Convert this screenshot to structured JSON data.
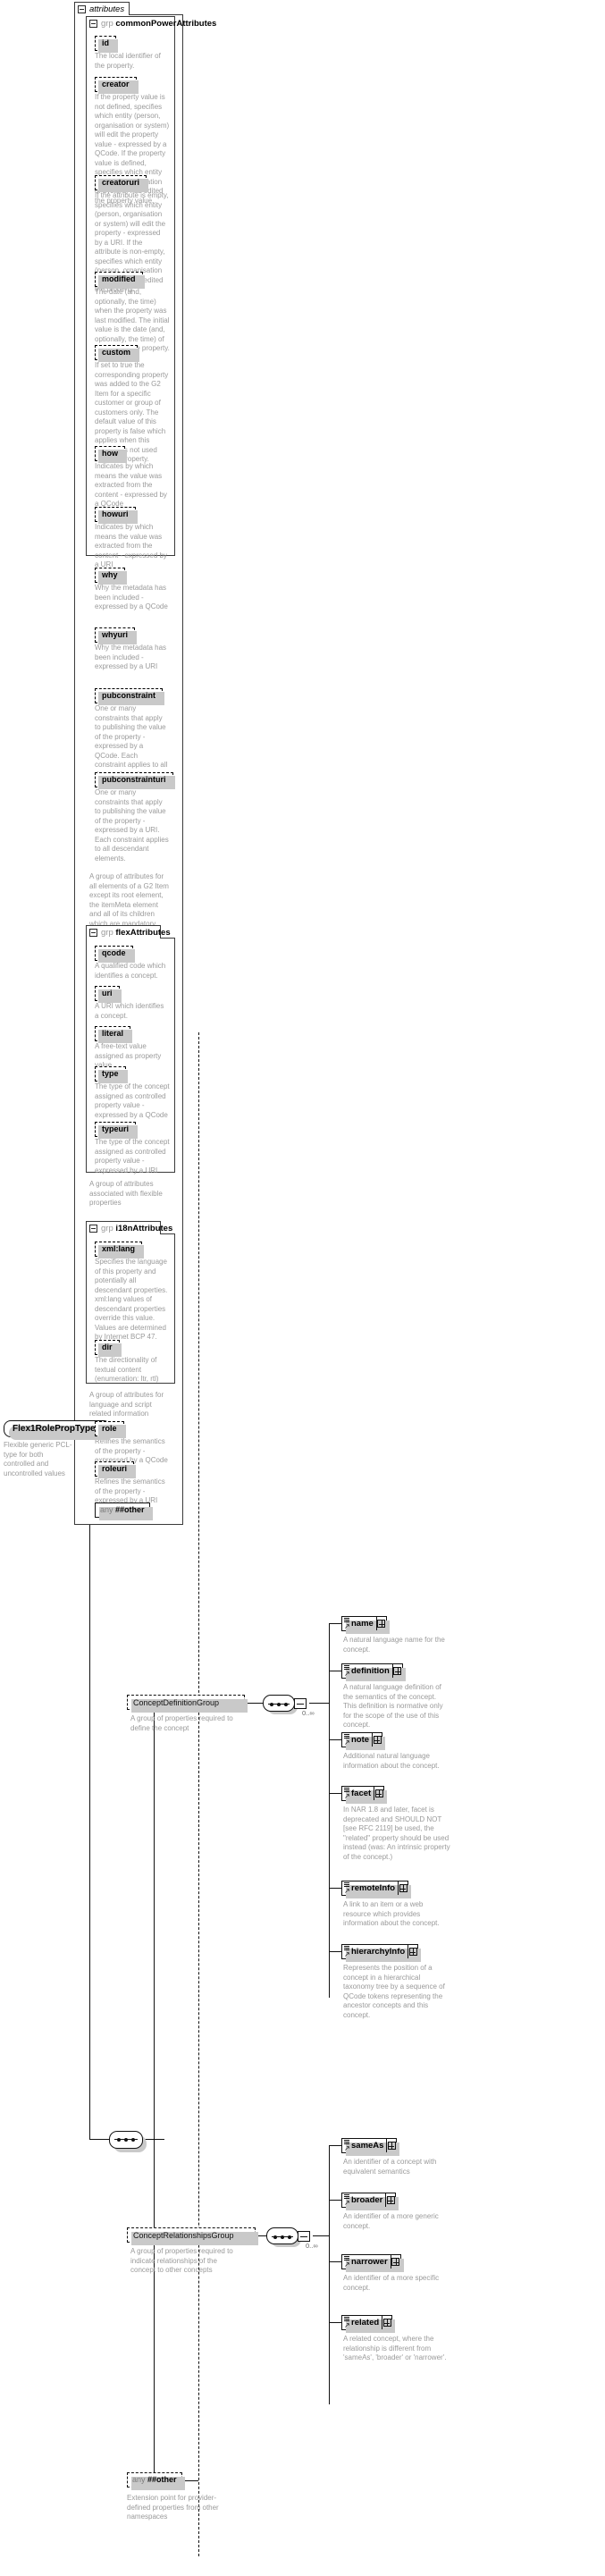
{
  "diagram": {
    "type": "xsd-schema-documentation",
    "root_type": "Flex1RolePropType",
    "root_type_doc": "Flexible generic PCL-type for both controlled and uncontrolled values",
    "attributes_tab_label": "attributes",
    "group_keyword": "grp",
    "any_keyword": "any"
  },
  "groups": {
    "commonPowerAttributes": {
      "name": "commonPowerAttributes",
      "footer": "A group of attributes for all elements of a G2 Item except its root element, the itemMeta element and all of its children which are mandatory.",
      "attributes": [
        {
          "name": "id",
          "doc": "The local identifier of the property."
        },
        {
          "name": "creator",
          "doc": "If the property value is not defined, specifies which entity (person, organisation or system) will edit the property value - expressed by a QCode. If the property value is defined, specifies which entity (person, organisation or system) has edited the property value."
        },
        {
          "name": "creatoruri",
          "doc": "If the attribute is empty, specifies which entity (person, organisation or system) will edit the property - expressed by a URI. If the attribute is non-empty, specifies which entity (person, organisation or system) has edited the property."
        },
        {
          "name": "modified",
          "doc": "The date (and, optionally, the time) when the property was last modified. The initial value is the date (and, optionally, the time) of creation of the property."
        },
        {
          "name": "custom",
          "doc": "If set to true the corresponding property was added to the G2 Item for a specific customer or group of customers only. The default value of this property is false which applies when this attribute is not used with the property."
        },
        {
          "name": "how",
          "doc": "Indicates by which means the value was extracted from the content - expressed by a QCode"
        },
        {
          "name": "howuri",
          "doc": "Indicates by which means the value was extracted from the content - expressed by a URI"
        },
        {
          "name": "why",
          "doc": "Why the metadata has been included - expressed by a QCode"
        },
        {
          "name": "whyuri",
          "doc": "Why the metadata has been included - expressed by a URI"
        },
        {
          "name": "pubconstraint",
          "doc": "One or many constraints that apply to publishing the value of the property - expressed by a QCode. Each constraint applies to all descendant elements."
        },
        {
          "name": "pubconstrainturi",
          "doc": "One or many constraints that apply to publishing the value of the property - expressed by a URI. Each constraint applies to all descendant elements."
        }
      ]
    },
    "flexAttributes": {
      "name": "flexAttributes",
      "footer": "A group of attributes associated with flexible properties",
      "attributes": [
        {
          "name": "qcode",
          "doc": "A qualified code which identifies a concept."
        },
        {
          "name": "uri",
          "doc": "A URI which identifies a concept."
        },
        {
          "name": "literal",
          "doc": "A free-text value assigned as property value."
        },
        {
          "name": "type",
          "doc": "The type of the concept assigned as controlled property value - expressed by a QCode"
        },
        {
          "name": "typeuri",
          "doc": "The type of the concept assigned as controlled property value - expressed by a URI"
        }
      ]
    },
    "i18nAttributes": {
      "name": "i18nAttributes",
      "footer": "A group of attributes for language and script related information",
      "attributes": [
        {
          "name": "xml:lang",
          "doc": "Specifies the language of this property and potentially all descendant properties. xml:lang values of descendant properties override this value. Values are determined by Internet BCP 47."
        },
        {
          "name": "dir",
          "doc": "The directionality of textual content (enumeration: ltr, rtl)"
        }
      ]
    }
  },
  "type_level_attributes": [
    {
      "name": "role",
      "doc": "Refines the semantics of the property - expressed by a QCode"
    },
    {
      "name": "roleuri",
      "doc": "Refines the semantics of the property - expressed by a URI"
    }
  ],
  "any_attribute": {
    "keyword": "any",
    "name": "##other"
  },
  "content_model": {
    "sequence_label": "sequence",
    "groups": [
      {
        "name": "ConceptDefinitionGroup",
        "doc": "A group of properties required to define the concept",
        "occurs": "0..∞",
        "elements": [
          {
            "name": "name",
            "doc": "A natural language name for the concept."
          },
          {
            "name": "definition",
            "doc": "A natural language definition of the semantics of the concept. This definition is normative only for the scope of the use of this concept."
          },
          {
            "name": "note",
            "doc": "Additional natural language information about the concept."
          },
          {
            "name": "facet",
            "doc": "In NAR 1.8 and later, facet is deprecated and SHOULD NOT [see RFC 2119] be used, the \"related\" property should be used instead (was: An intrinsic property of the concept.)"
          },
          {
            "name": "remoteInfo",
            "doc": "A link to an item or a web resource which provides information about the concept."
          },
          {
            "name": "hierarchyInfo",
            "doc": "Represents the position of a concept in a hierarchical taxonomy tree by a sequence of QCode tokens representing the ancestor concepts and this concept."
          }
        ]
      },
      {
        "name": "ConceptRelationshipsGroup",
        "doc": "A group of properties required to indicate relationships of the concept to other concepts",
        "occurs": "0..∞",
        "elements": [
          {
            "name": "sameAs",
            "doc": "An identifier of a concept with equivalent semantics"
          },
          {
            "name": "broader",
            "doc": "An identifier of a more generic concept."
          },
          {
            "name": "narrower",
            "doc": "An identifier of a more specific concept."
          },
          {
            "name": "related",
            "doc": "A related concept, where the relationship is different from 'sameAs', 'broader' or 'narrower'."
          }
        ]
      }
    ],
    "any_element": {
      "keyword": "any",
      "name": "##other",
      "doc": "Extension point for provider-defined properties from other namespaces"
    }
  }
}
